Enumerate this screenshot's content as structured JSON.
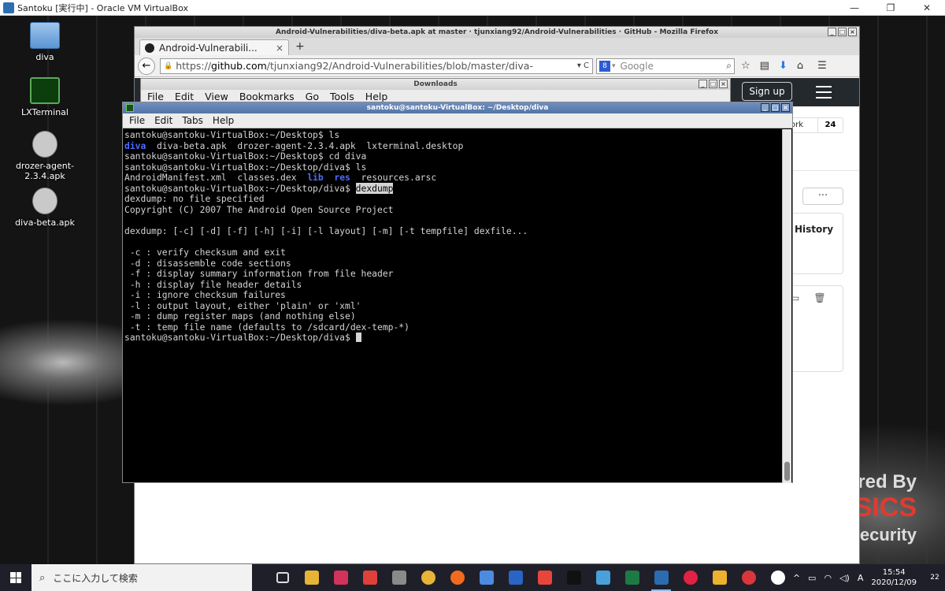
{
  "vbox": {
    "title": "Santoku [実行中] - Oracle VM VirtualBox",
    "minimize": "—",
    "restore": "❐",
    "close": "✕"
  },
  "desktop": {
    "icons": [
      {
        "label": "diva",
        "icon": "folder-icon"
      },
      {
        "label": "LXTerminal",
        "icon": "terminal-icon"
      },
      {
        "label": "drozer-agent-2.3.4.apk",
        "icon": "gear-icon"
      },
      {
        "label": "diva-beta.apk",
        "icon": "gear-icon"
      }
    ],
    "watermark": {
      "line1": "red By",
      "line2": "SICS",
      "line3": "ecurity"
    }
  },
  "firefox": {
    "title": "Android-Vulnerabilities/diva-beta.apk at master · tjunxiang92/Android-Vulnerabilities · GitHub - Mozilla Firefox",
    "tab_label": "Android-Vulnerabili...",
    "tab_close": "×",
    "new_tab": "+",
    "url_prefix": "https://",
    "url_domain": "github.com",
    "url_path": "/tjunxiang92/Android-Vulnerabilities/blob/master/diva-",
    "url_tail": "▾ C",
    "search_placeholder": "Google",
    "search_engine_badge": "8"
  },
  "github": {
    "signup": "Sign up",
    "fork_label": "ork",
    "fork_count": "24",
    "more": "···",
    "history": "History"
  },
  "downloads": {
    "title": "Downloads",
    "menu": [
      "File",
      "Edit",
      "View",
      "Bookmarks",
      "Go",
      "Tools",
      "Help"
    ]
  },
  "terminal": {
    "title": "santoku@santoku-VirtualBox: ~/Desktop/diva",
    "menu": [
      "File",
      "Edit",
      "Tabs",
      "Help"
    ],
    "lines": [
      [
        {
          "t": "santoku@santoku-VirtualBox:~/Desktop$ ls"
        }
      ],
      [
        {
          "t": "diva",
          "c": "blue"
        },
        {
          "t": "  diva-beta.apk  drozer-agent-2.3.4.apk  lxterminal.desktop"
        }
      ],
      [
        {
          "t": "santoku@santoku-VirtualBox:~/Desktop$ cd diva"
        }
      ],
      [
        {
          "t": "santoku@santoku-VirtualBox:~/Desktop/diva$ ls"
        }
      ],
      [
        {
          "t": "AndroidManifest.xml  classes.dex  "
        },
        {
          "t": "lib",
          "c": "blue"
        },
        {
          "t": "  "
        },
        {
          "t": "res",
          "c": "blue"
        },
        {
          "t": "  resources.arsc"
        }
      ],
      [
        {
          "t": "santoku@santoku-VirtualBox:~/Desktop/diva$ "
        },
        {
          "t": "dexdump",
          "c": "hl"
        }
      ],
      [
        {
          "t": "dexdump: no file specified"
        }
      ],
      [
        {
          "t": "Copyright (C) 2007 The Android Open Source Project"
        }
      ],
      [
        {
          "t": ""
        }
      ],
      [
        {
          "t": "dexdump: [-c] [-d] [-f] [-h] [-i] [-l layout] [-m] [-t tempfile] dexfile..."
        }
      ],
      [
        {
          "t": ""
        }
      ],
      [
        {
          "t": " -c : verify checksum and exit"
        }
      ],
      [
        {
          "t": " -d : disassemble code sections"
        }
      ],
      [
        {
          "t": " -f : display summary information from file header"
        }
      ],
      [
        {
          "t": " -h : display file header details"
        }
      ],
      [
        {
          "t": " -i : ignore checksum failures"
        }
      ],
      [
        {
          "t": " -l : output layout, either 'plain' or 'xml'"
        }
      ],
      [
        {
          "t": " -m : dump register maps (and nothing else)"
        }
      ],
      [
        {
          "t": " -t : temp file name (defaults to /sdcard/dex-temp-*)"
        }
      ],
      [
        {
          "t": "santoku@santoku-VirtualBox:~/Desktop/diva$ "
        },
        {
          "t": "",
          "c": "cursor"
        }
      ]
    ]
  },
  "taskbar": {
    "search_placeholder": "ここに入力して検索",
    "apps": [
      {
        "name": "task-view",
        "color": "#1f1f2a",
        "open": false
      },
      {
        "name": "file-explorer",
        "color": "#e8b437",
        "open": false
      },
      {
        "name": "app-red-square",
        "color": "#d3335a",
        "open": false
      },
      {
        "name": "app-refresh",
        "color": "#e0403a",
        "open": false
      },
      {
        "name": "app-pen",
        "color": "#8a8a8a",
        "open": false
      },
      {
        "name": "chrome",
        "color": "#e8b437",
        "open": false
      },
      {
        "name": "firefox",
        "color": "#f26b1d",
        "open": false
      },
      {
        "name": "app-notes",
        "color": "#4d8be0",
        "open": false
      },
      {
        "name": "app-feather",
        "color": "#2a64c4",
        "open": false
      },
      {
        "name": "app-bolt",
        "color": "#e8463a",
        "open": false
      },
      {
        "name": "terminal",
        "color": "#111111",
        "open": false
      },
      {
        "name": "app-blue",
        "color": "#4aa0d8",
        "open": false
      },
      {
        "name": "excel",
        "color": "#1e7a44",
        "open": false
      },
      {
        "name": "virtualbox",
        "color": "#2b6cb0",
        "open": true
      },
      {
        "name": "app-oo",
        "color": "#e02244",
        "open": false
      },
      {
        "name": "slack",
        "color": "#ecb22e",
        "open": false
      },
      {
        "name": "app-swirl",
        "color": "#d9373c",
        "open": false
      },
      {
        "name": "app-oo-white",
        "color": "#ffffff",
        "open": false
      }
    ],
    "tray_chevron": "^",
    "ime": "A",
    "time": "15:54",
    "date": "2020/12/09",
    "notifications": "22"
  }
}
